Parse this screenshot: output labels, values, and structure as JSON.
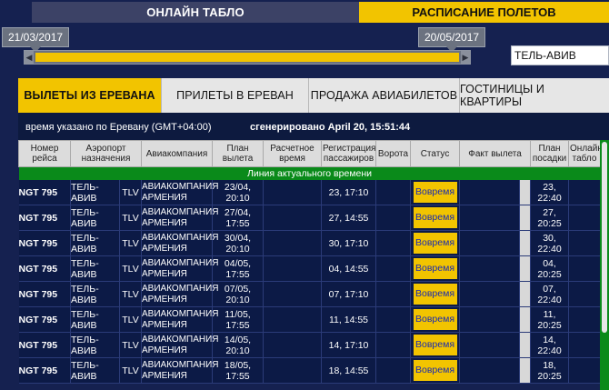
{
  "tabs": {
    "online": "ОНЛАЙН ТАБЛО",
    "schedule": "РАСПИСАНИЕ ПОЛЕТОВ"
  },
  "range": {
    "start": "21/03/2017",
    "end": "20/05/2017"
  },
  "destination": "ТЕЛЬ-АВИВ",
  "nav": [
    "ВЫЛЕТЫ ИЗ ЕРЕВАНА",
    "ПРИЛЕТЫ В ЕРЕВАН",
    "ПРОДАЖА АВИАБИЛЕТОВ",
    "ГОСТИНИЦЫ И КВАРТИРЫ"
  ],
  "info": {
    "timezone": "время указано по Еревану (GMT+04:00)",
    "generated": "сгенерировано April 20, 15:51:44"
  },
  "headers": [
    "Номер рейса",
    "Аэропорт назначения",
    "Авиакомпания",
    "План вылета",
    "Расчетное время",
    "Регистрация пассажиров",
    "Ворота",
    "Статус",
    "Факт вылета",
    "План посадки",
    "Онлайн табло"
  ],
  "timeline": "Линия актуального времени",
  "rows": [
    {
      "flight": "NGT 795",
      "dest": "ТЕЛЬ-АВИВ",
      "code": "TLV",
      "airline": "АВИАКОМПАНИЯ АРМЕНИЯ",
      "plan_date": "23/04,",
      "plan_time": "20:10",
      "reg": "23, 17:10",
      "status": "Вовремя",
      "land_date": "23,",
      "land_time": "22:40"
    },
    {
      "flight": "NGT 795",
      "dest": "ТЕЛЬ-АВИВ",
      "code": "TLV",
      "airline": "АВИАКОМПАНИЯ АРМЕНИЯ",
      "plan_date": "27/04,",
      "plan_time": "17:55",
      "reg": "27, 14:55",
      "status": "Вовремя",
      "land_date": "27,",
      "land_time": "20:25"
    },
    {
      "flight": "NGT 795",
      "dest": "ТЕЛЬ-АВИВ",
      "code": "TLV",
      "airline": "АВИАКОМПАНИЯ АРМЕНИЯ",
      "plan_date": "30/04,",
      "plan_time": "20:10",
      "reg": "30, 17:10",
      "status": "Вовремя",
      "land_date": "30,",
      "land_time": "22:40"
    },
    {
      "flight": "NGT 795",
      "dest": "ТЕЛЬ-АВИВ",
      "code": "TLV",
      "airline": "АВИАКОМПАНИЯ АРМЕНИЯ",
      "plan_date": "04/05,",
      "plan_time": "17:55",
      "reg": "04, 14:55",
      "status": "Вовремя",
      "land_date": "04,",
      "land_time": "20:25"
    },
    {
      "flight": "NGT 795",
      "dest": "ТЕЛЬ-АВИВ",
      "code": "TLV",
      "airline": "АВИАКОМПАНИЯ АРМЕНИЯ",
      "plan_date": "07/05,",
      "plan_time": "20:10",
      "reg": "07, 17:10",
      "status": "Вовремя",
      "land_date": "07,",
      "land_time": "22:40"
    },
    {
      "flight": "NGT 795",
      "dest": "ТЕЛЬ-АВИВ",
      "code": "TLV",
      "airline": "АВИАКОМПАНИЯ АРМЕНИЯ",
      "plan_date": "11/05,",
      "plan_time": "17:55",
      "reg": "11, 14:55",
      "status": "Вовремя",
      "land_date": "11,",
      "land_time": "20:25"
    },
    {
      "flight": "NGT 795",
      "dest": "ТЕЛЬ-АВИВ",
      "code": "TLV",
      "airline": "АВИАКОМПАНИЯ АРМЕНИЯ",
      "plan_date": "14/05,",
      "plan_time": "20:10",
      "reg": "14, 17:10",
      "status": "Вовремя",
      "land_date": "14,",
      "land_time": "22:40"
    },
    {
      "flight": "NGT 795",
      "dest": "ТЕЛЬ-АВИВ",
      "code": "TLV",
      "airline": "АВИАКОМПАНИЯ АРМЕНИЯ",
      "plan_date": "18/05,",
      "plan_time": "17:55",
      "reg": "18, 14:55",
      "status": "Вовремя",
      "land_date": "18,",
      "land_time": "20:25"
    }
  ]
}
